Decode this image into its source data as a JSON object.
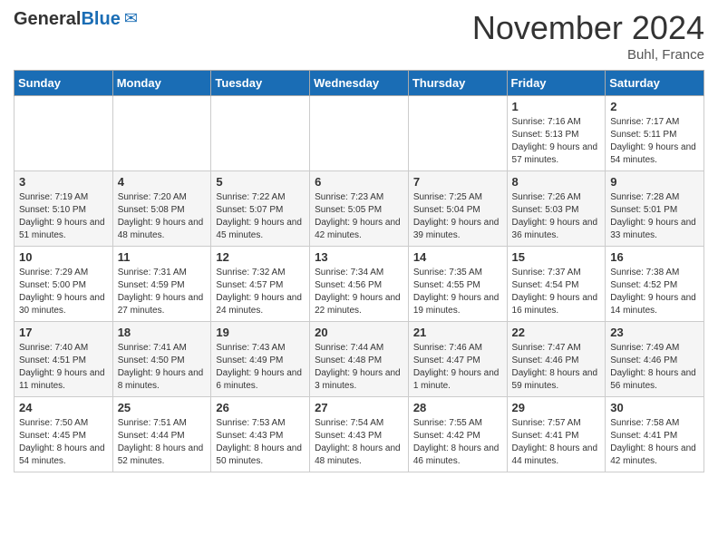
{
  "header": {
    "logo_general": "General",
    "logo_blue": "Blue",
    "title": "November 2024",
    "location": "Buhl, France"
  },
  "days_of_week": [
    "Sunday",
    "Monday",
    "Tuesday",
    "Wednesday",
    "Thursday",
    "Friday",
    "Saturday"
  ],
  "weeks": [
    [
      {
        "day": "",
        "content": ""
      },
      {
        "day": "",
        "content": ""
      },
      {
        "day": "",
        "content": ""
      },
      {
        "day": "",
        "content": ""
      },
      {
        "day": "",
        "content": ""
      },
      {
        "day": "1",
        "content": "Sunrise: 7:16 AM\nSunset: 5:13 PM\nDaylight: 9 hours and 57 minutes."
      },
      {
        "day": "2",
        "content": "Sunrise: 7:17 AM\nSunset: 5:11 PM\nDaylight: 9 hours and 54 minutes."
      }
    ],
    [
      {
        "day": "3",
        "content": "Sunrise: 7:19 AM\nSunset: 5:10 PM\nDaylight: 9 hours and 51 minutes."
      },
      {
        "day": "4",
        "content": "Sunrise: 7:20 AM\nSunset: 5:08 PM\nDaylight: 9 hours and 48 minutes."
      },
      {
        "day": "5",
        "content": "Sunrise: 7:22 AM\nSunset: 5:07 PM\nDaylight: 9 hours and 45 minutes."
      },
      {
        "day": "6",
        "content": "Sunrise: 7:23 AM\nSunset: 5:05 PM\nDaylight: 9 hours and 42 minutes."
      },
      {
        "day": "7",
        "content": "Sunrise: 7:25 AM\nSunset: 5:04 PM\nDaylight: 9 hours and 39 minutes."
      },
      {
        "day": "8",
        "content": "Sunrise: 7:26 AM\nSunset: 5:03 PM\nDaylight: 9 hours and 36 minutes."
      },
      {
        "day": "9",
        "content": "Sunrise: 7:28 AM\nSunset: 5:01 PM\nDaylight: 9 hours and 33 minutes."
      }
    ],
    [
      {
        "day": "10",
        "content": "Sunrise: 7:29 AM\nSunset: 5:00 PM\nDaylight: 9 hours and 30 minutes."
      },
      {
        "day": "11",
        "content": "Sunrise: 7:31 AM\nSunset: 4:59 PM\nDaylight: 9 hours and 27 minutes."
      },
      {
        "day": "12",
        "content": "Sunrise: 7:32 AM\nSunset: 4:57 PM\nDaylight: 9 hours and 24 minutes."
      },
      {
        "day": "13",
        "content": "Sunrise: 7:34 AM\nSunset: 4:56 PM\nDaylight: 9 hours and 22 minutes."
      },
      {
        "day": "14",
        "content": "Sunrise: 7:35 AM\nSunset: 4:55 PM\nDaylight: 9 hours and 19 minutes."
      },
      {
        "day": "15",
        "content": "Sunrise: 7:37 AM\nSunset: 4:54 PM\nDaylight: 9 hours and 16 minutes."
      },
      {
        "day": "16",
        "content": "Sunrise: 7:38 AM\nSunset: 4:52 PM\nDaylight: 9 hours and 14 minutes."
      }
    ],
    [
      {
        "day": "17",
        "content": "Sunrise: 7:40 AM\nSunset: 4:51 PM\nDaylight: 9 hours and 11 minutes."
      },
      {
        "day": "18",
        "content": "Sunrise: 7:41 AM\nSunset: 4:50 PM\nDaylight: 9 hours and 8 minutes."
      },
      {
        "day": "19",
        "content": "Sunrise: 7:43 AM\nSunset: 4:49 PM\nDaylight: 9 hours and 6 minutes."
      },
      {
        "day": "20",
        "content": "Sunrise: 7:44 AM\nSunset: 4:48 PM\nDaylight: 9 hours and 3 minutes."
      },
      {
        "day": "21",
        "content": "Sunrise: 7:46 AM\nSunset: 4:47 PM\nDaylight: 9 hours and 1 minute."
      },
      {
        "day": "22",
        "content": "Sunrise: 7:47 AM\nSunset: 4:46 PM\nDaylight: 8 hours and 59 minutes."
      },
      {
        "day": "23",
        "content": "Sunrise: 7:49 AM\nSunset: 4:46 PM\nDaylight: 8 hours and 56 minutes."
      }
    ],
    [
      {
        "day": "24",
        "content": "Sunrise: 7:50 AM\nSunset: 4:45 PM\nDaylight: 8 hours and 54 minutes."
      },
      {
        "day": "25",
        "content": "Sunrise: 7:51 AM\nSunset: 4:44 PM\nDaylight: 8 hours and 52 minutes."
      },
      {
        "day": "26",
        "content": "Sunrise: 7:53 AM\nSunset: 4:43 PM\nDaylight: 8 hours and 50 minutes."
      },
      {
        "day": "27",
        "content": "Sunrise: 7:54 AM\nSunset: 4:43 PM\nDaylight: 8 hours and 48 minutes."
      },
      {
        "day": "28",
        "content": "Sunrise: 7:55 AM\nSunset: 4:42 PM\nDaylight: 8 hours and 46 minutes."
      },
      {
        "day": "29",
        "content": "Sunrise: 7:57 AM\nSunset: 4:41 PM\nDaylight: 8 hours and 44 minutes."
      },
      {
        "day": "30",
        "content": "Sunrise: 7:58 AM\nSunset: 4:41 PM\nDaylight: 8 hours and 42 minutes."
      }
    ]
  ]
}
